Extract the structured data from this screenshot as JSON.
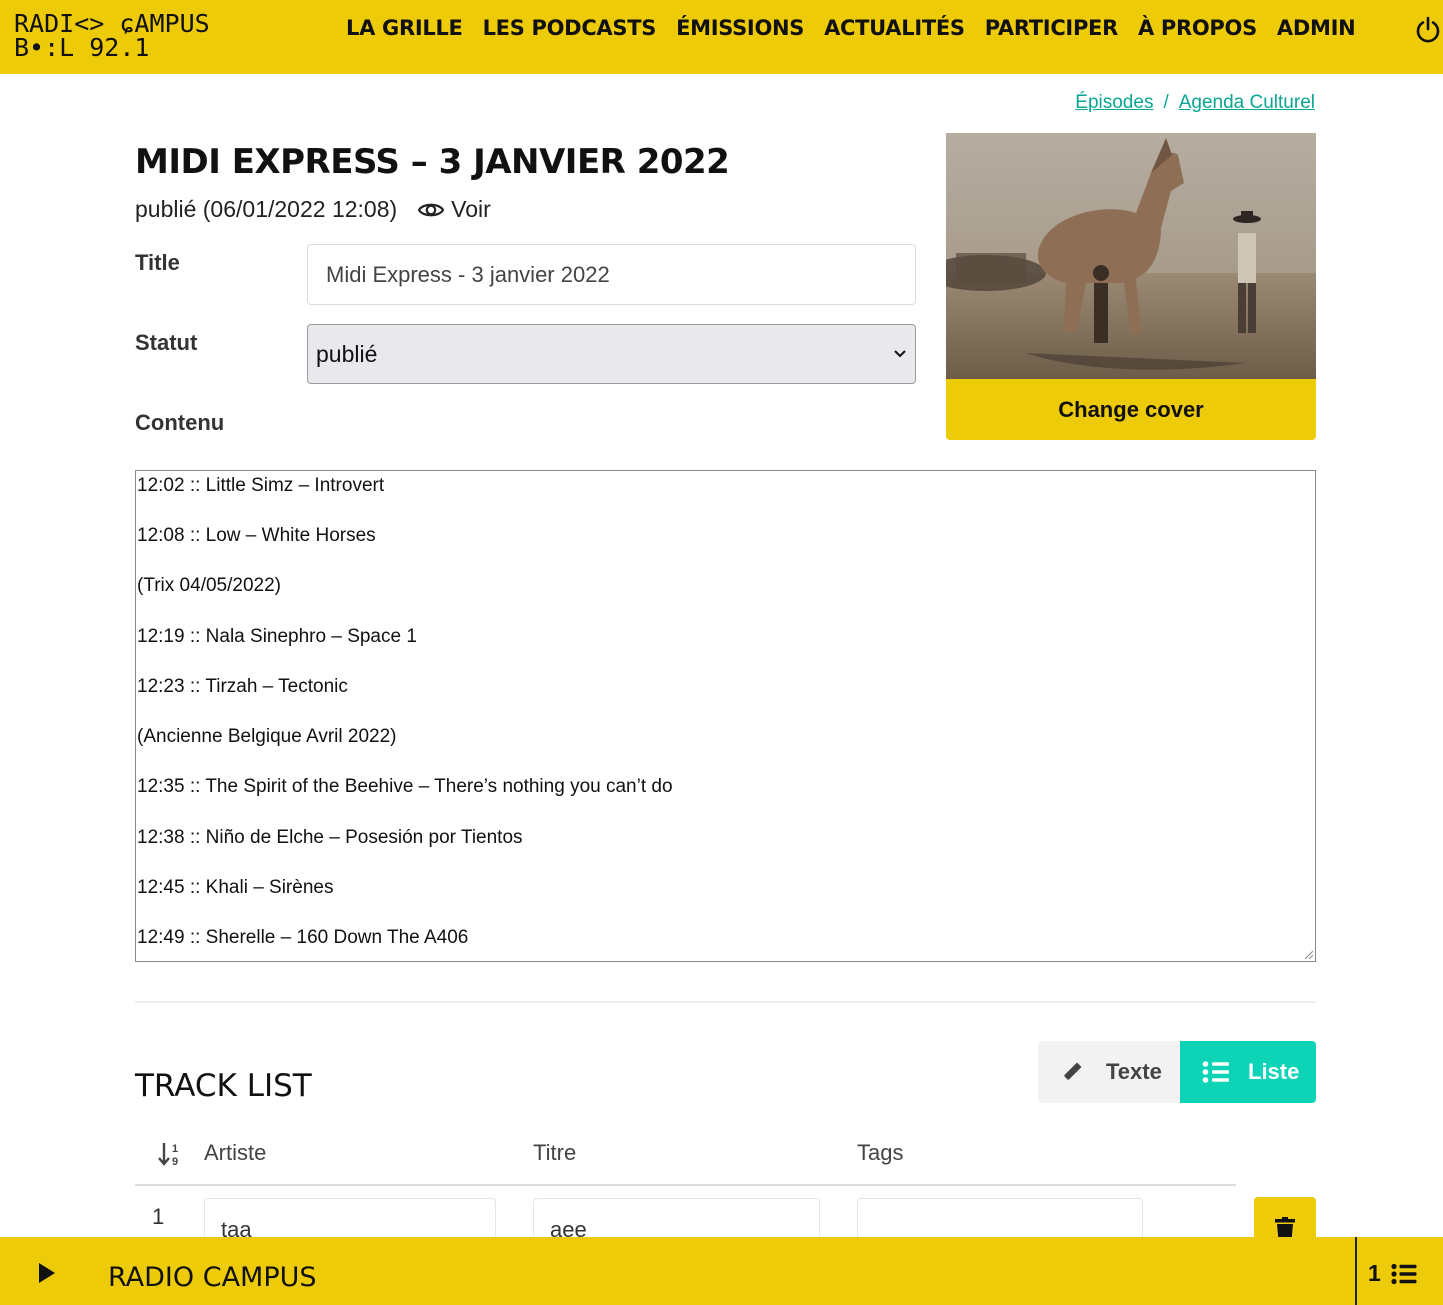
{
  "header": {
    "logo_line1": "RADI<> ɕAMPUS",
    "logo_line2": "B•:L 92.1",
    "nav": [
      "LA GRILLE",
      "LES PODCASTS",
      "ÉMISSIONS",
      "ACTUALITÉS",
      "PARTICIPER",
      "À PROPOS",
      "ADMIN"
    ],
    "brand_color": "#eecb09"
  },
  "breadcrumb": {
    "item1": "Épisodes",
    "separator": "/",
    "item2": "Agenda Culturel"
  },
  "episode": {
    "title": "MIDI EXPRESS – 3 JANVIER 2022",
    "status_line": "publié (06/01/2022 12:08)",
    "view_label": "Voir"
  },
  "form": {
    "title_label": "Title",
    "title_value": "Midi Express - 3 janvier 2022",
    "status_label": "Statut",
    "status_value": "publié",
    "content_label": "Contenu",
    "change_cover_label": "Change cover",
    "content_lines": [
      "12:02 :: Little Simz – Introvert",
      "12:08 :: Low – White Horses",
      "(Trix 04/05/2022)",
      "12:19 :: Nala Sinephro – Space 1",
      "12:23 :: Tirzah – Tectonic",
      "(Ancienne Belgique Avril 2022)",
      "12:35 :: The Spirit of the Beehive – There’s nothing you can’t do",
      "12:38 :: Niño de Elche – Posesión por Tientos",
      "12:45 :: Khali – Sirènes",
      "12:49 :: Sherelle – 160 Down The A406"
    ]
  },
  "tracklist": {
    "title": "TRACK LIST",
    "toggle_texte": "Texte",
    "toggle_liste": "Liste",
    "active_mode": "Liste",
    "accent_color": "#0dd4b6",
    "columns": [
      "Artiste",
      "Titre",
      "Tags"
    ],
    "rows": [
      {
        "index": "1",
        "artiste": "taa",
        "titre": "aee",
        "tags": ""
      }
    ]
  },
  "player": {
    "title": "RADIO CAMPUS",
    "queue_count": "1"
  }
}
